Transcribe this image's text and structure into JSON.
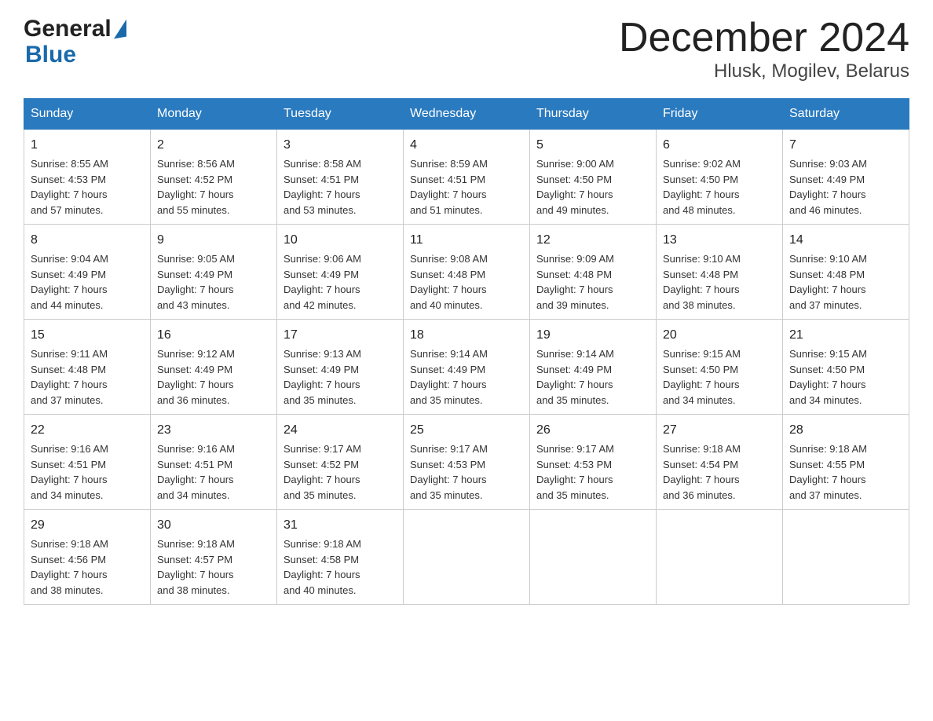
{
  "header": {
    "title": "December 2024",
    "subtitle": "Hlusk, Mogilev, Belarus",
    "logo_general": "General",
    "logo_blue": "Blue"
  },
  "columns": [
    "Sunday",
    "Monday",
    "Tuesday",
    "Wednesday",
    "Thursday",
    "Friday",
    "Saturday"
  ],
  "weeks": [
    [
      {
        "day": "1",
        "sunrise": "8:55 AM",
        "sunset": "4:53 PM",
        "daylight": "7 hours and 57 minutes."
      },
      {
        "day": "2",
        "sunrise": "8:56 AM",
        "sunset": "4:52 PM",
        "daylight": "7 hours and 55 minutes."
      },
      {
        "day": "3",
        "sunrise": "8:58 AM",
        "sunset": "4:51 PM",
        "daylight": "7 hours and 53 minutes."
      },
      {
        "day": "4",
        "sunrise": "8:59 AM",
        "sunset": "4:51 PM",
        "daylight": "7 hours and 51 minutes."
      },
      {
        "day": "5",
        "sunrise": "9:00 AM",
        "sunset": "4:50 PM",
        "daylight": "7 hours and 49 minutes."
      },
      {
        "day": "6",
        "sunrise": "9:02 AM",
        "sunset": "4:50 PM",
        "daylight": "7 hours and 48 minutes."
      },
      {
        "day": "7",
        "sunrise": "9:03 AM",
        "sunset": "4:49 PM",
        "daylight": "7 hours and 46 minutes."
      }
    ],
    [
      {
        "day": "8",
        "sunrise": "9:04 AM",
        "sunset": "4:49 PM",
        "daylight": "7 hours and 44 minutes."
      },
      {
        "day": "9",
        "sunrise": "9:05 AM",
        "sunset": "4:49 PM",
        "daylight": "7 hours and 43 minutes."
      },
      {
        "day": "10",
        "sunrise": "9:06 AM",
        "sunset": "4:49 PM",
        "daylight": "7 hours and 42 minutes."
      },
      {
        "day": "11",
        "sunrise": "9:08 AM",
        "sunset": "4:48 PM",
        "daylight": "7 hours and 40 minutes."
      },
      {
        "day": "12",
        "sunrise": "9:09 AM",
        "sunset": "4:48 PM",
        "daylight": "7 hours and 39 minutes."
      },
      {
        "day": "13",
        "sunrise": "9:10 AM",
        "sunset": "4:48 PM",
        "daylight": "7 hours and 38 minutes."
      },
      {
        "day": "14",
        "sunrise": "9:10 AM",
        "sunset": "4:48 PM",
        "daylight": "7 hours and 37 minutes."
      }
    ],
    [
      {
        "day": "15",
        "sunrise": "9:11 AM",
        "sunset": "4:48 PM",
        "daylight": "7 hours and 37 minutes."
      },
      {
        "day": "16",
        "sunrise": "9:12 AM",
        "sunset": "4:49 PM",
        "daylight": "7 hours and 36 minutes."
      },
      {
        "day": "17",
        "sunrise": "9:13 AM",
        "sunset": "4:49 PM",
        "daylight": "7 hours and 35 minutes."
      },
      {
        "day": "18",
        "sunrise": "9:14 AM",
        "sunset": "4:49 PM",
        "daylight": "7 hours and 35 minutes."
      },
      {
        "day": "19",
        "sunrise": "9:14 AM",
        "sunset": "4:49 PM",
        "daylight": "7 hours and 35 minutes."
      },
      {
        "day": "20",
        "sunrise": "9:15 AM",
        "sunset": "4:50 PM",
        "daylight": "7 hours and 34 minutes."
      },
      {
        "day": "21",
        "sunrise": "9:15 AM",
        "sunset": "4:50 PM",
        "daylight": "7 hours and 34 minutes."
      }
    ],
    [
      {
        "day": "22",
        "sunrise": "9:16 AM",
        "sunset": "4:51 PM",
        "daylight": "7 hours and 34 minutes."
      },
      {
        "day": "23",
        "sunrise": "9:16 AM",
        "sunset": "4:51 PM",
        "daylight": "7 hours and 34 minutes."
      },
      {
        "day": "24",
        "sunrise": "9:17 AM",
        "sunset": "4:52 PM",
        "daylight": "7 hours and 35 minutes."
      },
      {
        "day": "25",
        "sunrise": "9:17 AM",
        "sunset": "4:53 PM",
        "daylight": "7 hours and 35 minutes."
      },
      {
        "day": "26",
        "sunrise": "9:17 AM",
        "sunset": "4:53 PM",
        "daylight": "7 hours and 35 minutes."
      },
      {
        "day": "27",
        "sunrise": "9:18 AM",
        "sunset": "4:54 PM",
        "daylight": "7 hours and 36 minutes."
      },
      {
        "day": "28",
        "sunrise": "9:18 AM",
        "sunset": "4:55 PM",
        "daylight": "7 hours and 37 minutes."
      }
    ],
    [
      {
        "day": "29",
        "sunrise": "9:18 AM",
        "sunset": "4:56 PM",
        "daylight": "7 hours and 38 minutes."
      },
      {
        "day": "30",
        "sunrise": "9:18 AM",
        "sunset": "4:57 PM",
        "daylight": "7 hours and 38 minutes."
      },
      {
        "day": "31",
        "sunrise": "9:18 AM",
        "sunset": "4:58 PM",
        "daylight": "7 hours and 40 minutes."
      },
      null,
      null,
      null,
      null
    ]
  ],
  "labels": {
    "sunrise": "Sunrise:",
    "sunset": "Sunset:",
    "daylight": "Daylight:"
  }
}
